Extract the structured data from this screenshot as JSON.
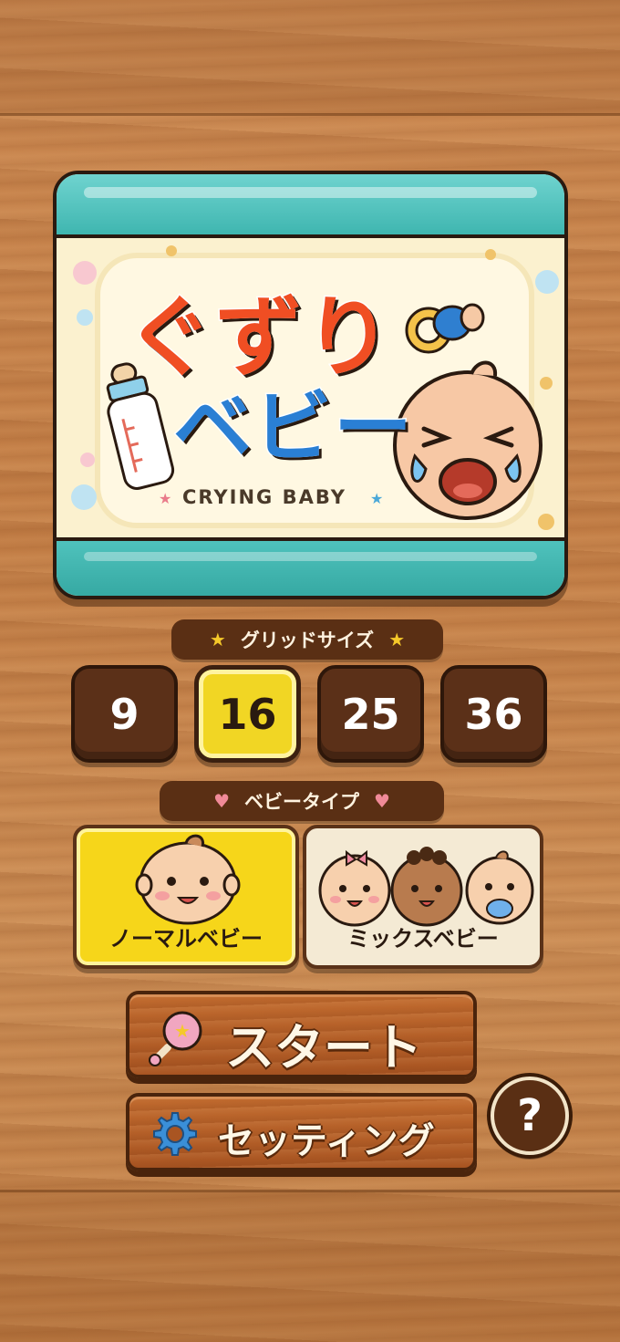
{
  "logo": {
    "title_line1": "ぐずり",
    "title_line2": "ベビー",
    "subtitle": "CRYING BABY"
  },
  "grid_size": {
    "label": "グリッドサイズ",
    "options": [
      "9",
      "16",
      "25",
      "36"
    ],
    "selected": "16"
  },
  "baby_type": {
    "label": "ベビータイプ",
    "options": [
      "ノーマルベビー",
      "ミックスベビー"
    ],
    "selected": "ノーマルベビー"
  },
  "buttons": {
    "start": "スタート",
    "settings": "セッティング",
    "help": "?"
  },
  "colors": {
    "accent_yellow": "#f1d624",
    "teal": "#3fb6b0",
    "title_red": "#f04e23",
    "title_blue": "#2a7fd4",
    "wood_dark": "#5a2f14"
  },
  "icons": {
    "star": "star-icon",
    "heart": "heart-icon",
    "rattle": "rattle-icon",
    "gear": "gear-icon",
    "bottle": "baby-bottle-icon",
    "pacifier": "pacifier-icon"
  }
}
